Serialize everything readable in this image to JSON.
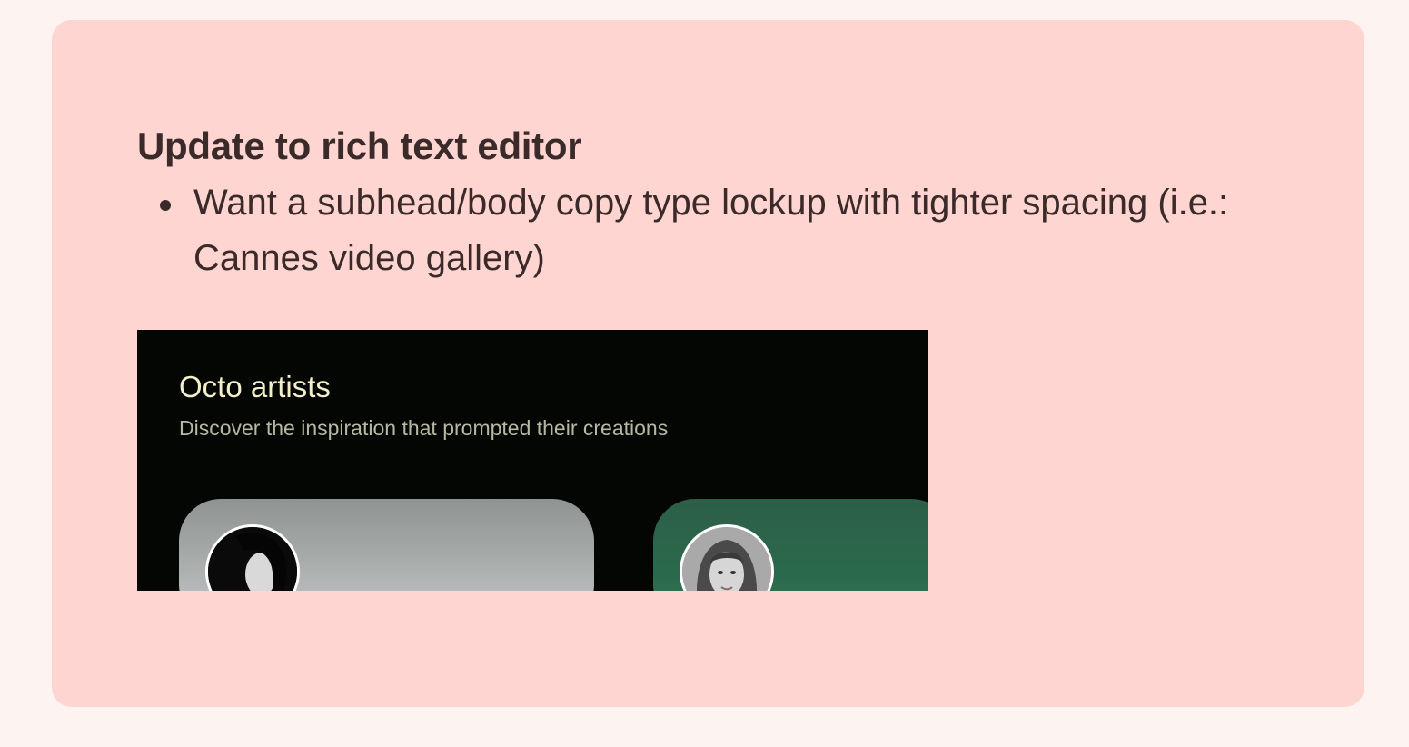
{
  "note": {
    "heading": "Update to rich text editor",
    "bullets": [
      "Want a subhead/body copy type lockup with tighter spacing (i.e.: Cannes video gallery)"
    ]
  },
  "screenshot": {
    "title": "Octo artists",
    "subtitle": "Discover the inspiration that prompted their creations",
    "artists": [
      {
        "avatar_icon": "portrait-photo"
      },
      {
        "avatar_icon": "portrait-photo"
      }
    ]
  },
  "colors": {
    "page_background": "#fdf3f1",
    "card_background": "#ffd5d1",
    "text": "#3b2a2a",
    "screenshot_background": "#040604",
    "screenshot_title": "#f3efc9",
    "screenshot_subtitle": "#b6b8a2"
  }
}
